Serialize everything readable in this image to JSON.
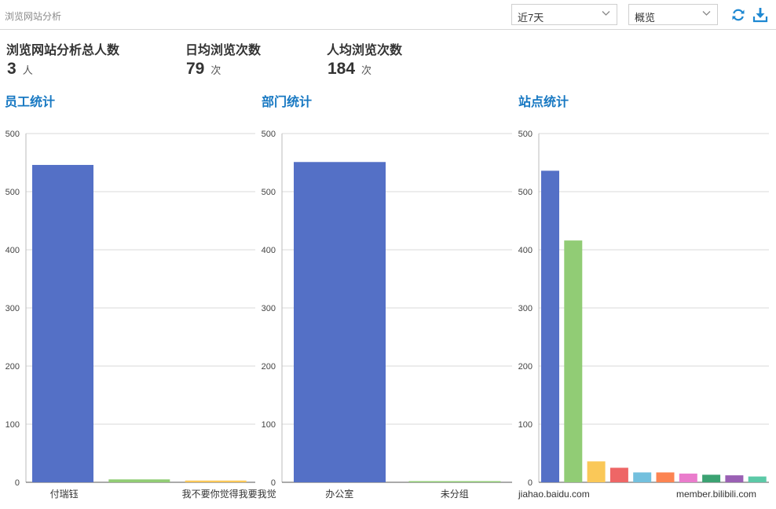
{
  "header": {
    "breadcrumb": "浏览网站分析",
    "period_select": "近7天",
    "view_select": "概览"
  },
  "kpis": [
    {
      "label": "浏览网站分析总人数",
      "value": "3",
      "unit": "人"
    },
    {
      "label": "日均浏览次数",
      "value": "79",
      "unit": "次"
    },
    {
      "label": "人均浏览次数",
      "value": "184",
      "unit": "次"
    }
  ],
  "colors": {
    "title_blue": "#1778c2",
    "palette": [
      "#5470c6",
      "#91cc75",
      "#fac858",
      "#ee6666",
      "#73c0de",
      "#fc8452",
      "#ea7ccc",
      "#3ba272",
      "#9a60b4",
      "#5cc9a7"
    ]
  },
  "chart_data": [
    {
      "type": "bar",
      "title": "员工统计",
      "ylim": [
        0,
        600
      ],
      "yticks_shown": [
        "500",
        "500",
        "400",
        "300",
        "200",
        "100",
        "0"
      ],
      "grid": true,
      "categories": [
        "付瑞钰",
        "",
        "我不要你觉得我要我觉"
      ],
      "values": [
        546,
        5,
        3
      ]
    },
    {
      "type": "bar",
      "title": "部门统计",
      "ylim": [
        0,
        600
      ],
      "yticks_shown": [
        "500",
        "500",
        "400",
        "300",
        "200",
        "100",
        "0"
      ],
      "grid": true,
      "categories": [
        "办公室",
        "未分组"
      ],
      "values": [
        551,
        2
      ]
    },
    {
      "type": "bar",
      "title": "站点统计",
      "ylim": [
        0,
        600
      ],
      "yticks_shown": [
        "500",
        "500",
        "400",
        "300",
        "200",
        "100",
        "0"
      ],
      "grid": true,
      "categories": [
        "jiahao.baidu.com",
        "",
        "",
        "",
        "",
        "",
        "",
        "",
        "",
        "member.bilibili.com"
      ],
      "values": [
        536,
        416,
        36,
        25,
        17,
        17,
        15,
        13,
        12,
        10
      ]
    }
  ]
}
